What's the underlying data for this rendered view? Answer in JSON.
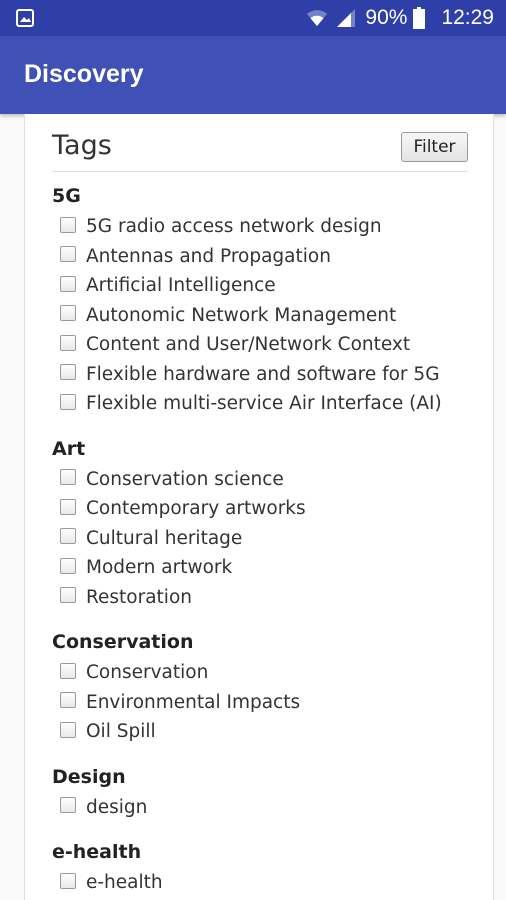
{
  "status_bar": {
    "notification_icon": "image-notification-icon",
    "wifi_icon": "wifi-icon",
    "signal_icon": "signal-icon",
    "battery_text": "90%",
    "battery_icon": "battery-icon",
    "time": "12:29"
  },
  "app_bar": {
    "title": "Discovery"
  },
  "tags": {
    "title": "Tags",
    "filter_label": "Filter",
    "groups": [
      {
        "title": "5G",
        "items": [
          "5G radio access network design",
          "Antennas and Propagation",
          "Artificial Intelligence",
          "Autonomic Network Management",
          "Content and User/Network Context",
          "Flexible hardware and software for 5G",
          "Flexible multi-service Air Interface (AI)"
        ]
      },
      {
        "title": "Art",
        "items": [
          "Conservation science",
          "Contemporary artworks",
          "Cultural heritage",
          "Modern artwork",
          "Restoration"
        ]
      },
      {
        "title": "Conservation",
        "items": [
          "Conservation",
          "Environmental Impacts",
          "Oil Spill"
        ]
      },
      {
        "title": "Design",
        "items": [
          "design"
        ]
      },
      {
        "title": "e-health",
        "items": [
          "e-health"
        ]
      }
    ]
  },
  "colors": {
    "status_bar": "#2e40a8",
    "app_bar": "#3f51b5"
  }
}
